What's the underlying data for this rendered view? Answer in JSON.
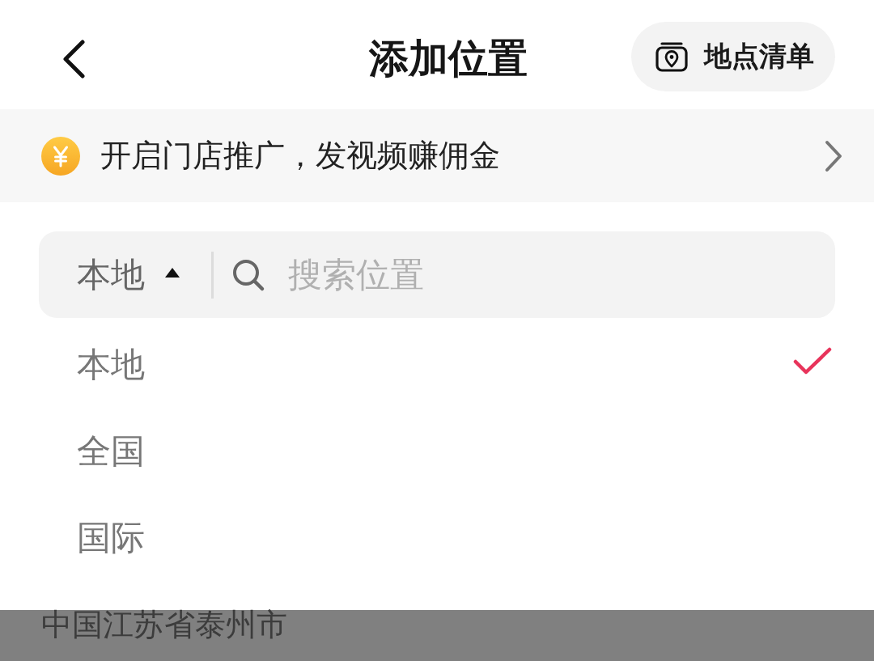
{
  "header": {
    "title": "添加位置",
    "list_button": {
      "label": "地点清单"
    }
  },
  "promo_banner": {
    "text": "开启门店推广，发视频赚佣金"
  },
  "search": {
    "scope": {
      "label": "本地",
      "expanded": true
    },
    "placeholder": "搜索位置"
  },
  "scope_menu": [
    {
      "label": "本地",
      "selected": true
    },
    {
      "label": "全国",
      "selected": false
    },
    {
      "label": "国际",
      "selected": false
    }
  ],
  "background_list": {
    "location": "中国江苏省泰州市"
  }
}
